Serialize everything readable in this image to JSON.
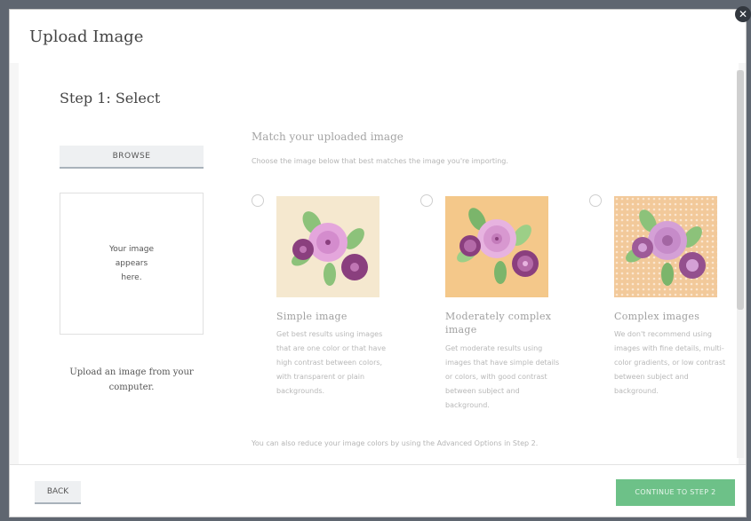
{
  "dialog": {
    "title": "Upload Image",
    "close_icon": "close-icon"
  },
  "step": {
    "title": "Step 1: Select",
    "browse_label": "BROWSE",
    "preview_placeholder": "Your image appears here.",
    "upload_hint": "Upload an image from your computer."
  },
  "match": {
    "title": "Match your uploaded image",
    "subtitle": "Choose the image below that best matches the image you're importing.",
    "options": [
      {
        "title": "Simple image",
        "description": "Get best results using images that are one color or that have high contrast between colors, with transparent or plain backgrounds.",
        "background": "#f5e8cf"
      },
      {
        "title": "Moderately complex image",
        "description": "Get moderate results using images that have simple details or colors, with good contrast between subject and background.",
        "background": "#f4c88a"
      },
      {
        "title": "Complex images",
        "description": "We don't recommend using images with fine details, multi-color gradients, or low contrast between subject and background.",
        "background": "#f2c99a"
      }
    ],
    "footnote": "You can also reduce your image colors by using the Advanced Options in Step 2."
  },
  "footer": {
    "back_label": "BACK",
    "continue_label": "CONTINUE TO STEP 2"
  },
  "colors": {
    "accent_green": "#6dc188",
    "flower_pink": "#e4a6dc",
    "flower_purple": "#8a3f7e",
    "leaf_green": "#8cc27a"
  }
}
